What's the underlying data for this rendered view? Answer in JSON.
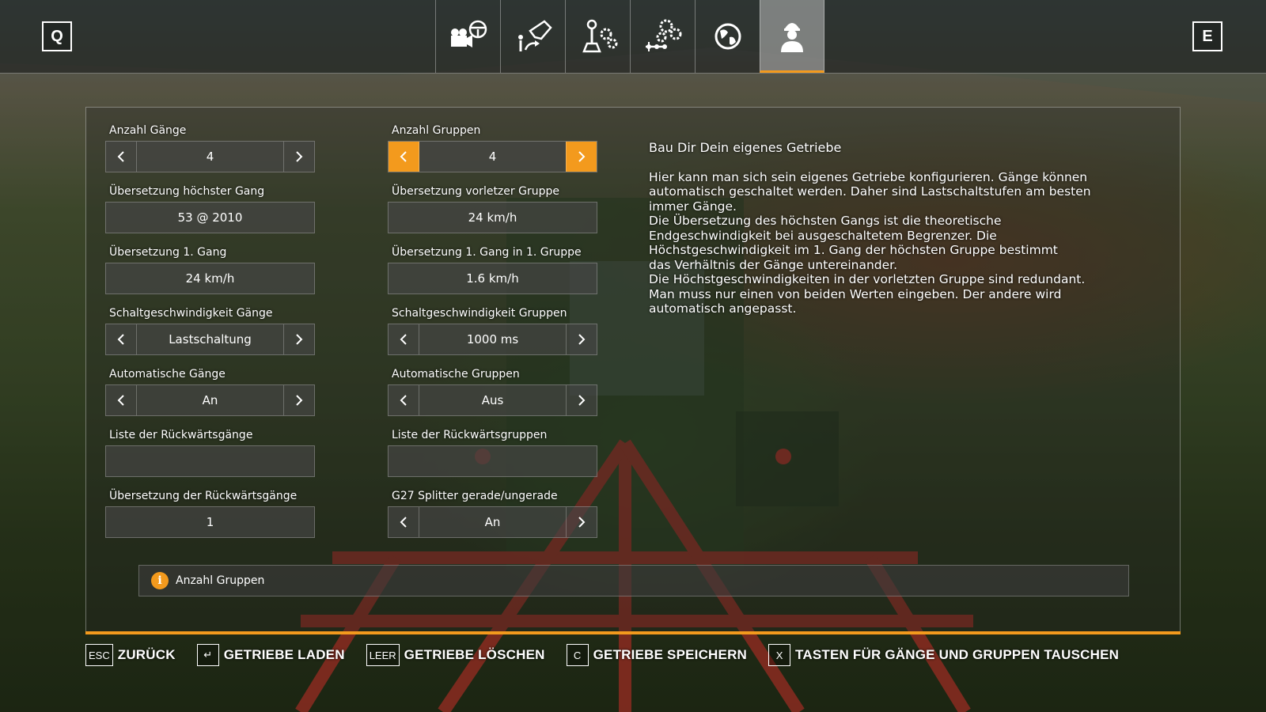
{
  "topbar": {
    "left_key": "Q",
    "right_key": "E",
    "tabs": [
      {
        "icon": "camera-steering-icon",
        "active": false
      },
      {
        "icon": "controls-hand-icon",
        "active": false
      },
      {
        "icon": "gearshift-settings-icon",
        "active": false
      },
      {
        "icon": "mechanics-gears-icon",
        "active": false
      },
      {
        "icon": "globe-icon",
        "active": false
      },
      {
        "icon": "user-profile-icon",
        "active": true
      }
    ]
  },
  "accent_color": "#f39a1d",
  "left_column": [
    {
      "label": "Anzahl Gänge",
      "type": "stepper",
      "value": "4"
    },
    {
      "label": "Übersetzung höchster Gang",
      "type": "input",
      "value": "53 @ 2010"
    },
    {
      "label": "Übersetzung 1. Gang",
      "type": "input",
      "value": "24 km/h"
    },
    {
      "label": "Schaltgeschwindigkeit Gänge",
      "type": "stepper",
      "value": "Lastschaltung"
    },
    {
      "label": "Automatische Gänge",
      "type": "stepper",
      "value": "An"
    },
    {
      "label": "Liste der Rückwärtsgänge",
      "type": "input",
      "value": ""
    },
    {
      "label": "Übersetzung der Rückwärtsgänge",
      "type": "input",
      "value": "1"
    }
  ],
  "right_column": [
    {
      "label": "Anzahl Gruppen",
      "type": "stepper",
      "value": "4",
      "focused": true
    },
    {
      "label": "Übersetzung vorletzer Gruppe",
      "type": "input",
      "value": "24 km/h"
    },
    {
      "label": "Übersetzung 1. Gang in 1. Gruppe",
      "type": "input",
      "value": "1.6 km/h"
    },
    {
      "label": "Schaltgeschwindigkeit Gruppen",
      "type": "stepper",
      "value": "1000 ms"
    },
    {
      "label": "Automatische Gruppen",
      "type": "stepper",
      "value": "Aus"
    },
    {
      "label": "Liste der Rückwärtsgruppen",
      "type": "input",
      "value": ""
    },
    {
      "label": "G27 Splitter gerade/ungerade",
      "type": "stepper",
      "value": "An"
    }
  ],
  "description": {
    "title": "Bau Dir Dein eigenes Getriebe",
    "paragraphs": [
      "Hier kann man sich sein eigenes Getriebe konfigurieren. Gänge können\nautomatisch geschaltet werden. Daher sind Lastschaltstufen am besten\nimmer Gänge.",
      "Die Übersetzung des höchsten Gangs ist die theoretische\nEndgeschwindigkeit bei ausgeschaltetem Begrenzer. Die\nHöchstgeschwindigkeit im 1. Gang der höchsten Gruppe bestimmt\ndas Verhältnis der Gänge untereinander.",
      "Die Höchstgeschwindigkeiten in der vorletzten Gruppe sind redundant.\nMan muss nur einen von beiden Werten eingeben. Der andere wird\nautomatisch angepasst."
    ]
  },
  "info_bar": {
    "icon": "info-icon",
    "glyph": "i",
    "text": "Anzahl Gruppen"
  },
  "footer": [
    {
      "key": "ESC",
      "label": "ZURÜCK"
    },
    {
      "key": "↵",
      "label": "GETRIEBE LADEN"
    },
    {
      "key": "LEER",
      "label": "GETRIEBE LÖSCHEN"
    },
    {
      "key": "C",
      "label": "GETRIEBE SPEICHERN"
    },
    {
      "key": "X",
      "label": "TASTEN FÜR GÄNGE UND GRUPPEN TAUSCHEN"
    }
  ]
}
